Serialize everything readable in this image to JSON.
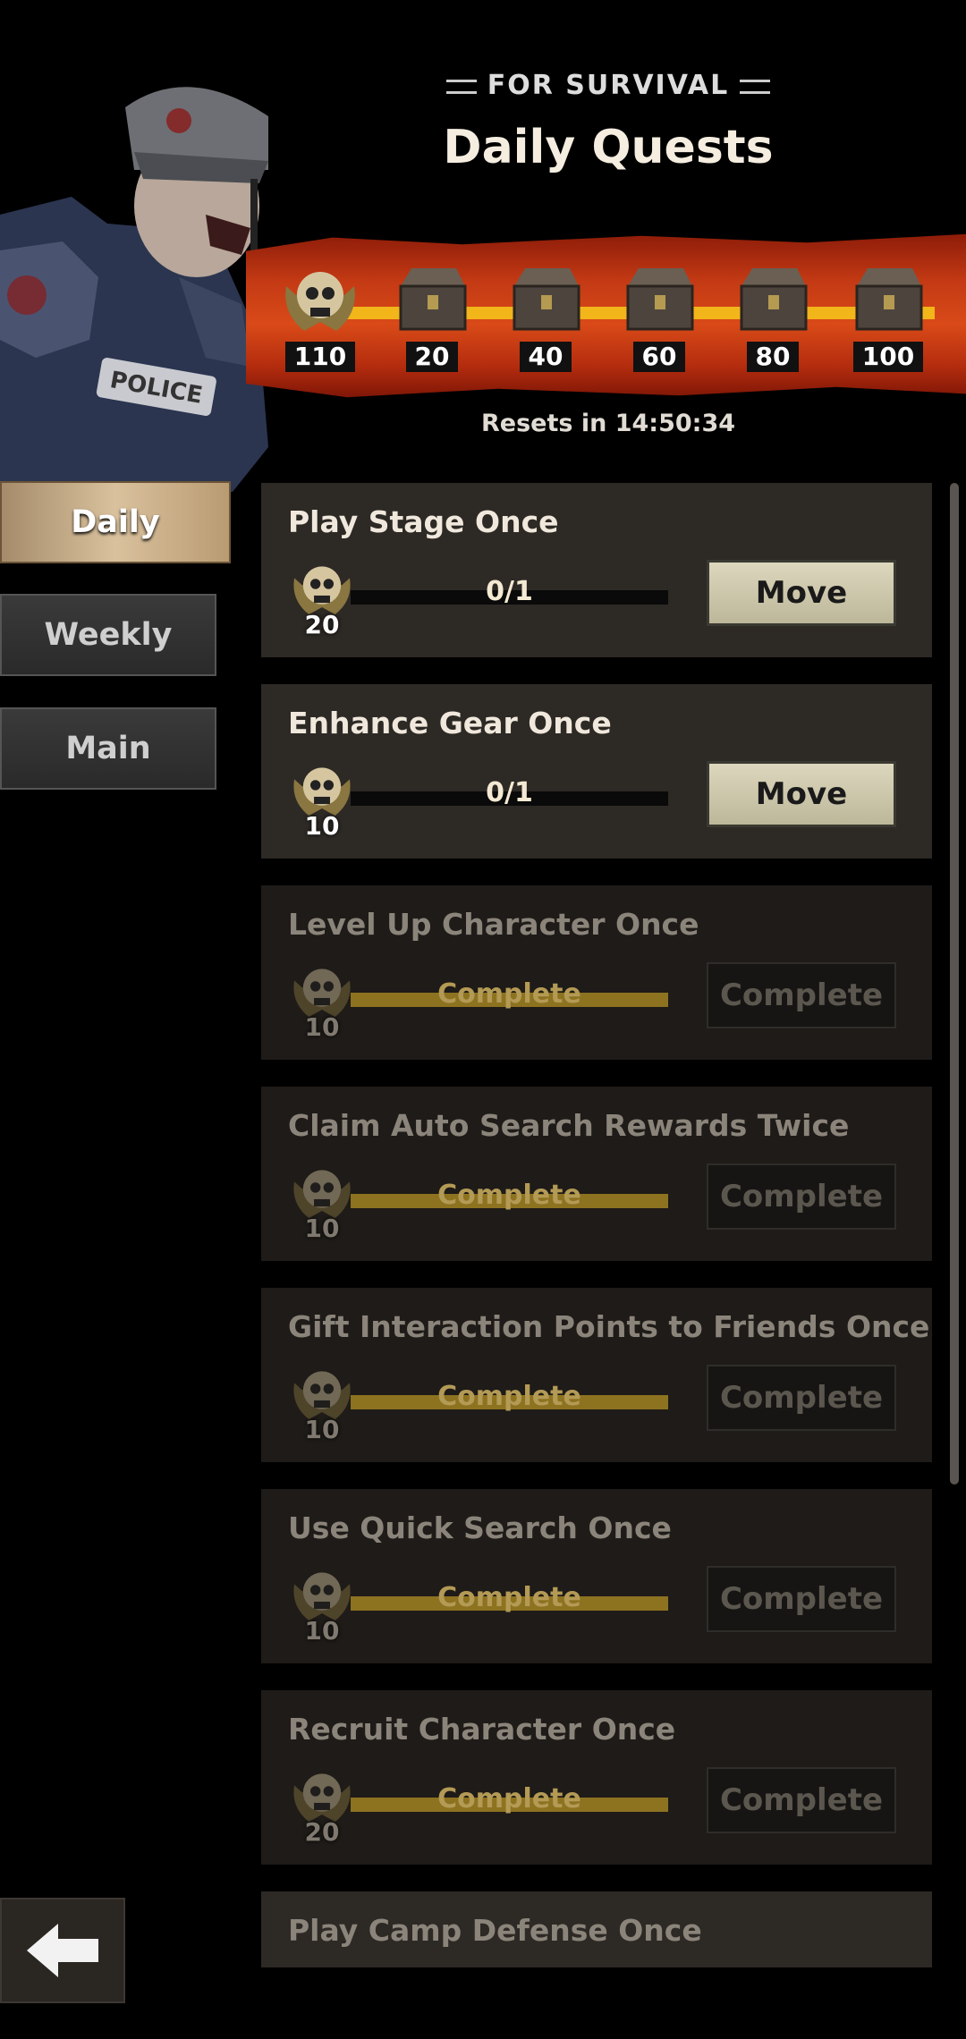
{
  "header": {
    "subtitle": "FOR SURVIVAL",
    "title": "Daily Quests",
    "reset_text": "Resets in 14:50:34"
  },
  "milestones": [
    {
      "label": "110",
      "icon": "skull-medal-icon"
    },
    {
      "label": "20",
      "icon": "chest-icon"
    },
    {
      "label": "40",
      "icon": "chest-icon"
    },
    {
      "label": "60",
      "icon": "chest-icon"
    },
    {
      "label": "80",
      "icon": "chest-icon"
    },
    {
      "label": "100",
      "icon": "chest-icon"
    }
  ],
  "tabs": [
    {
      "label": "Daily",
      "active": true
    },
    {
      "label": "Weekly",
      "active": false
    },
    {
      "label": "Main",
      "active": false
    }
  ],
  "quests": [
    {
      "name": "Play Stage Once",
      "reward": "20",
      "progress": "0/1",
      "button": "Move",
      "done": false
    },
    {
      "name": "Enhance Gear Once",
      "reward": "10",
      "progress": "0/1",
      "button": "Move",
      "done": false
    },
    {
      "name": "Level Up Character Once",
      "reward": "10",
      "progress": "Complete",
      "button": "Complete",
      "done": true
    },
    {
      "name": "Claim Auto Search Rewards Twice",
      "reward": "10",
      "progress": "Complete",
      "button": "Complete",
      "done": true
    },
    {
      "name": "Gift Interaction Points to Friends Once",
      "reward": "10",
      "progress": "Complete",
      "button": "Complete",
      "done": true
    },
    {
      "name": "Use Quick Search Once",
      "reward": "10",
      "progress": "Complete",
      "button": "Complete",
      "done": true
    },
    {
      "name": "Recruit Character Once",
      "reward": "20",
      "progress": "Complete",
      "button": "Complete",
      "done": true
    },
    {
      "name": "Play Camp Defense Once",
      "reward": "",
      "progress": "",
      "button": "",
      "done": false
    }
  ],
  "colors": {
    "banner": "#c43a14",
    "progress_line": "#f2b51a",
    "card": "#2d2925",
    "card_done": "#1e1b18"
  }
}
